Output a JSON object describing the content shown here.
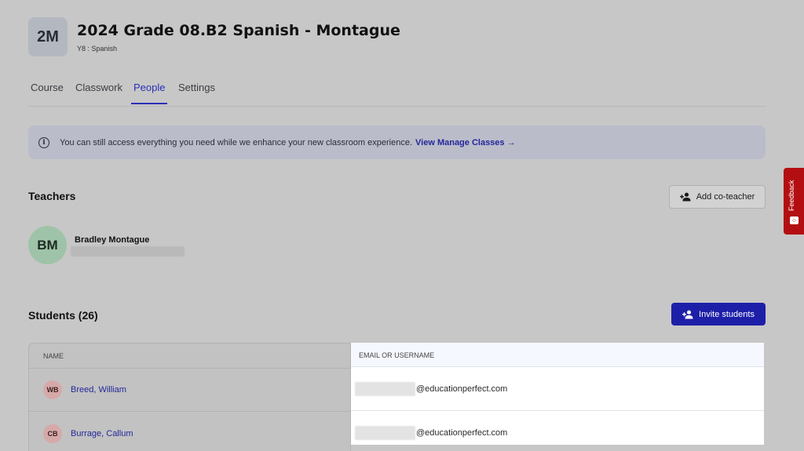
{
  "header": {
    "avatar_initials": "2M",
    "title": "2024 Grade 08.B2 Spanish - Montague",
    "subtitle": "Y8 : Spanish"
  },
  "tabs": [
    {
      "label": "Course",
      "active": false
    },
    {
      "label": "Classwork",
      "active": false
    },
    {
      "label": "People",
      "active": true
    },
    {
      "label": "Settings",
      "active": false
    }
  ],
  "banner": {
    "icon": "info-icon",
    "message": "You can still access everything you need while we enhance your new classroom experience.",
    "link_label": "View Manage Classes →"
  },
  "teachers": {
    "title": "Teachers",
    "add_button_label": "Add co-teacher",
    "items": [
      {
        "initials": "BM",
        "name": "Bradley Montague"
      }
    ]
  },
  "students": {
    "title": "Students (26)",
    "invite_button_label": "Invite students",
    "columns": [
      "NAME",
      "EMAIL OR USERNAME"
    ],
    "rows": [
      {
        "initials": "WB",
        "name": "Breed, William",
        "email_domain": "@educationperfect.com"
      },
      {
        "initials": "CB",
        "name": "Burrage, Callum",
        "email_domain": "@educationperfect.com"
      }
    ]
  },
  "feedback": {
    "label": "Feedback"
  },
  "colors": {
    "accent": "#1d1fa8",
    "link": "#23279a",
    "feedback": "#b30f12"
  }
}
